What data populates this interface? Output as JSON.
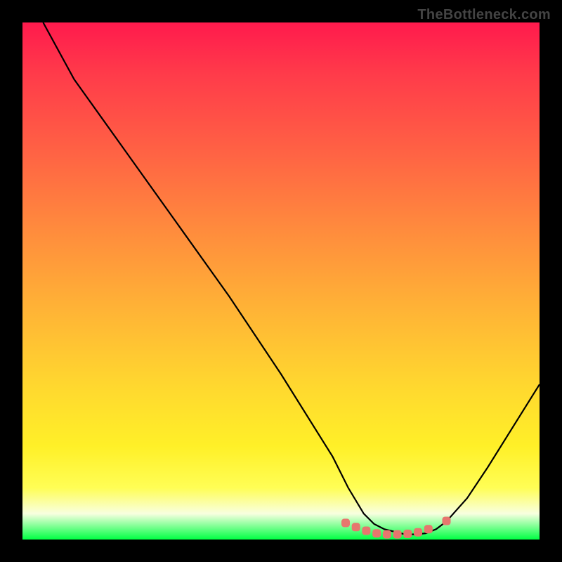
{
  "watermark": "TheBottleneck.com",
  "chart_data": {
    "type": "line",
    "title": "",
    "xlabel": "",
    "ylabel": "",
    "xlim": [
      0,
      100
    ],
    "ylim": [
      0,
      100
    ],
    "series": [
      {
        "name": "bottleneck-curve",
        "x": [
          4,
          10,
          20,
          30,
          40,
          50,
          60,
          63,
          66,
          68,
          70,
          72,
          74,
          76,
          78,
          80,
          82,
          86,
          90,
          95,
          100
        ],
        "y": [
          100,
          89,
          75,
          61,
          47,
          32,
          16,
          10,
          5,
          3,
          2,
          1.5,
          1,
          1,
          1.2,
          2,
          3.5,
          8,
          14,
          22,
          30
        ]
      }
    ],
    "markers": {
      "name": "marker-points",
      "color": "#e6766e",
      "points": [
        {
          "x": 62.5,
          "y": 3.2
        },
        {
          "x": 64.5,
          "y": 2.4
        },
        {
          "x": 66.5,
          "y": 1.7
        },
        {
          "x": 68.5,
          "y": 1.2
        },
        {
          "x": 70.5,
          "y": 1.0
        },
        {
          "x": 72.5,
          "y": 1.0
        },
        {
          "x": 74.5,
          "y": 1.1
        },
        {
          "x": 76.5,
          "y": 1.4
        },
        {
          "x": 78.5,
          "y": 2.0
        },
        {
          "x": 82.0,
          "y": 3.6
        }
      ]
    }
  }
}
